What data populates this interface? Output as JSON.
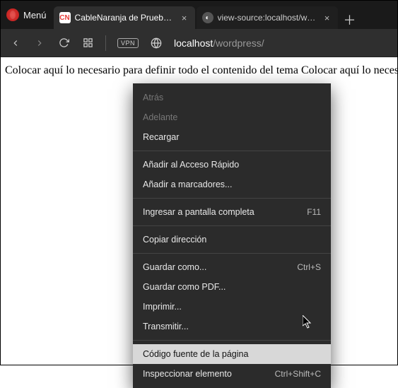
{
  "menu": {
    "label": "Menú"
  },
  "tabs": {
    "active": {
      "title": "CableNaranja de Prueba - C",
      "favletter": "CN"
    },
    "inactive": {
      "title": "view-source:localhost/worc",
      "favicon_glyph": "◐"
    }
  },
  "newtab_glyph": "＋",
  "address": {
    "vpn": "VPN",
    "host": "localhost",
    "path": "/wordpress/"
  },
  "page": {
    "text": "Colocar aquí lo necesario para definir todo el contenido del tema Colocar aquí lo necesario :"
  },
  "contextmenu": {
    "back": "Atrás",
    "forward": "Adelante",
    "reload": "Recargar",
    "speeddial": "Añadir al Acceso Rápido",
    "bookmark": "Añadir a marcadores...",
    "fullscreen": "Ingresar a pantalla completa",
    "fullscreen_sc": "F11",
    "copyaddr": "Copiar dirección",
    "saveas": "Guardar como...",
    "saveas_sc": "Ctrl+S",
    "savepdf": "Guardar como PDF...",
    "print": "Imprimir...",
    "cast": "Transmitir...",
    "viewsource": "Código fuente de la página",
    "inspect": "Inspeccionar elemento",
    "inspect_sc": "Ctrl+Shift+C"
  }
}
